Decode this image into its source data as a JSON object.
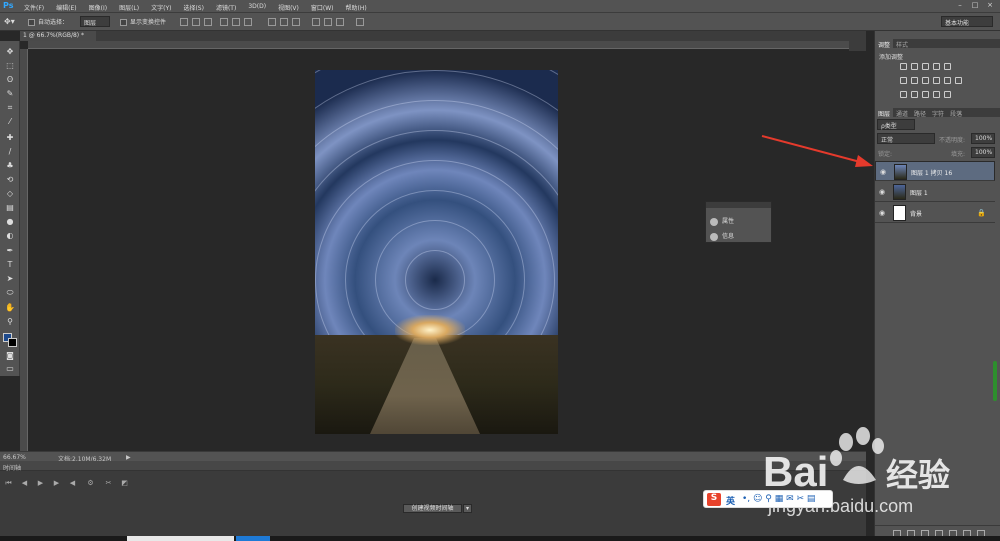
{
  "app": {
    "logo": "Ps"
  },
  "menu": [
    "文件(F)",
    "编辑(E)",
    "图像(I)",
    "图层(L)",
    "文字(Y)",
    "选择(S)",
    "滤镜(T)",
    "3D(D)",
    "视图(V)",
    "窗口(W)",
    "帮助(H)"
  ],
  "window_controls": {
    "minimize": "–",
    "maximize": "□",
    "close": "×"
  },
  "options": {
    "auto_select_label": "自动选择：",
    "auto_select_value": "图层",
    "show_transform_label": "显示变换控件",
    "workspace": "基本功能"
  },
  "doc_tab": "1 @ 66.7%(RGB/8) *",
  "status": {
    "zoom": "66.67%",
    "doc_size": "文档:2.10M/6.32M",
    "arrow": "▶"
  },
  "timeline": {
    "title": "时间轴",
    "create_button": "创建视频时间轴",
    "dropdown": "▾"
  },
  "float_panel": {
    "items": [
      "属性",
      "信息"
    ]
  },
  "right_panel": {
    "adjust_tabs": [
      "调整",
      "样式"
    ],
    "adjust_title": "添加调整",
    "layer_tabs": [
      "图层",
      "通道",
      "路径",
      "字符",
      "段落"
    ],
    "filter_kind": "ρ类型",
    "blend_mode": "正常",
    "opacity_label": "不透明度:",
    "opacity_value": "100%",
    "lock_label": "锁定:",
    "fill_label": "填充:",
    "fill_value": "100%",
    "layers": [
      {
        "name": "图层 1 拷贝 16",
        "selected": true,
        "locked": false
      },
      {
        "name": "图层 1",
        "selected": false,
        "locked": false
      },
      {
        "name": "背景",
        "selected": false,
        "locked": true
      }
    ]
  },
  "watermark": {
    "brand": "Bai",
    "brand2": "经验",
    "url": "jingyan.baidu.com"
  },
  "ime": {
    "label": "英"
  }
}
